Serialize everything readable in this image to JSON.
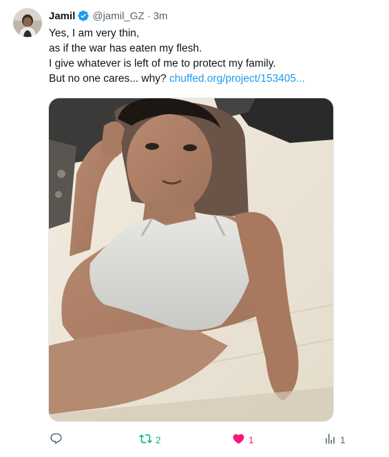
{
  "author": {
    "name": "Jamil",
    "handle": "@jamil_GZ",
    "separator": "·",
    "time": "3m",
    "verified": true
  },
  "post": {
    "lines": [
      "Yes, I am very thin,",
      "as if the war has eaten my flesh.",
      "I give whatever is left of me to protect my family.",
      "But no one cares... why?"
    ],
    "link_text": "chuffed.org/project/153405..."
  },
  "actions": {
    "reply_count": "",
    "retweet_count": "2",
    "like_count": "1",
    "views_count": "1"
  },
  "colors": {
    "link": "#1d9bf0",
    "verified": "#1d9bf0",
    "retweet_active": "#00ba7c",
    "like_active": "#f91880",
    "muted": "#536471"
  },
  "icons": {
    "reply": "reply-icon",
    "retweet": "retweet-icon",
    "like": "heart-icon",
    "views": "views-icon",
    "verified": "verified-badge-icon"
  }
}
